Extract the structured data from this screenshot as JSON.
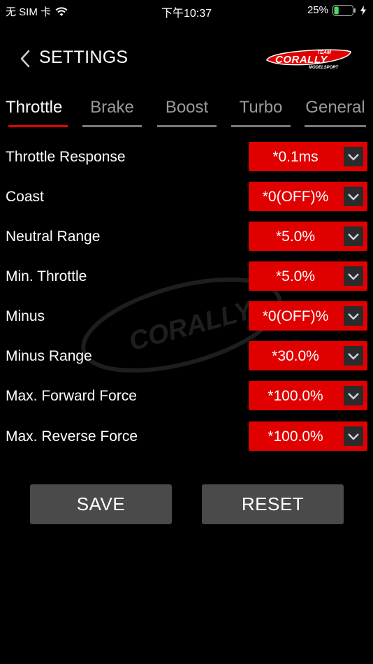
{
  "status_bar": {
    "carrier": "无 SIM 卡",
    "time": "下午10:37",
    "battery_percent": "25%",
    "battery_level": 0.25
  },
  "header": {
    "title": "SETTINGS",
    "logo_text_top": "TEAM",
    "logo_text_main": "CORALLY",
    "logo_text_bottom": "MODELSPORT"
  },
  "tabs": [
    {
      "label": "Throttle",
      "active": true
    },
    {
      "label": "Brake",
      "active": false
    },
    {
      "label": "Boost",
      "active": false
    },
    {
      "label": "Turbo",
      "active": false
    },
    {
      "label": "General",
      "active": false
    }
  ],
  "settings": [
    {
      "label": "Throttle Response",
      "value": "*0.1ms"
    },
    {
      "label": "Coast",
      "value": "*0(OFF)%"
    },
    {
      "label": "Neutral Range",
      "value": "*5.0%"
    },
    {
      "label": "Min. Throttle",
      "value": "*5.0%"
    },
    {
      "label": "Minus",
      "value": "*0(OFF)%"
    },
    {
      "label": "Minus Range",
      "value": "*30.0%"
    },
    {
      "label": "Max. Forward Force",
      "value": "*100.0%"
    },
    {
      "label": "Max. Reverse Force",
      "value": "*100.0%"
    }
  ],
  "buttons": {
    "save": "SAVE",
    "reset": "RESET"
  },
  "colors": {
    "accent": "#e10000",
    "background": "#000000",
    "button": "#4a4a4a"
  }
}
